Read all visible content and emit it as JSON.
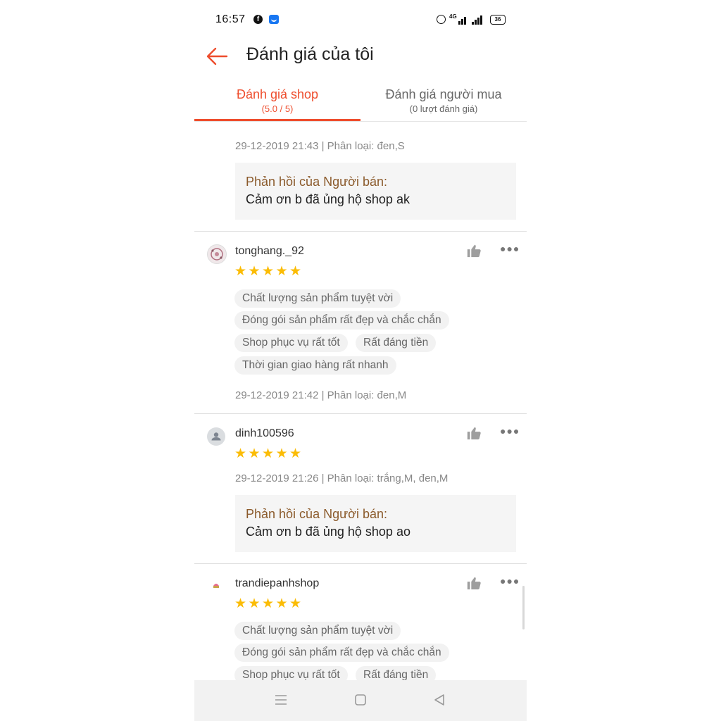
{
  "status_bar": {
    "time": "16:57",
    "network": "4G",
    "battery": "36"
  },
  "header": {
    "title": "Đánh giá của tôi"
  },
  "tabs": [
    {
      "label": "Đánh giá shop",
      "sub": "(5.0 / 5)"
    },
    {
      "label": "Đánh giá người mua",
      "sub": "(0 lượt đánh giá)"
    }
  ],
  "reviews": [
    {
      "meta": "29-12-2019 21:43 | Phân loại: đen,S",
      "reply": {
        "title": "Phản hồi của Người bán:",
        "text": "Cảm ơn b đã ủng hộ shop ak"
      }
    },
    {
      "username": "tonghang._92",
      "stars": 5,
      "tags": [
        "Chất lượng sản phẩm tuyệt vời",
        "Đóng gói sản phẩm rất đẹp và chắc chắn",
        "Shop phục vụ rất tốt",
        "Rất đáng tiền",
        "Thời gian giao hàng rất nhanh"
      ],
      "meta": "29-12-2019 21:42 | Phân loại: đen,M"
    },
    {
      "username": "dinh100596",
      "stars": 5,
      "meta": "29-12-2019 21:26 | Phân loại: trắng,M, đen,M",
      "reply": {
        "title": "Phản hồi của Người bán:",
        "text": "Cảm ơn b đã ủng hộ shop ao"
      }
    },
    {
      "username": "trandiepanhshop",
      "stars": 5,
      "tags": [
        "Chất lượng sản phẩm tuyệt vời",
        "Đóng gói sản phẩm rất đẹp và chắc chắn",
        "Shop phục vụ rất tốt",
        "Rất đáng tiền"
      ]
    }
  ],
  "colors": {
    "accent": "#ee4d2d",
    "star": "#fbbc05",
    "reply_title": "#8b5a2b"
  },
  "icons": [
    "back-arrow-icon",
    "facebook-icon",
    "messenger-icon",
    "alarm-icon",
    "signal-icon",
    "battery-icon",
    "thumbs-up-icon",
    "more-icon",
    "star-icon",
    "menu-icon",
    "home-icon",
    "back-icon"
  ]
}
